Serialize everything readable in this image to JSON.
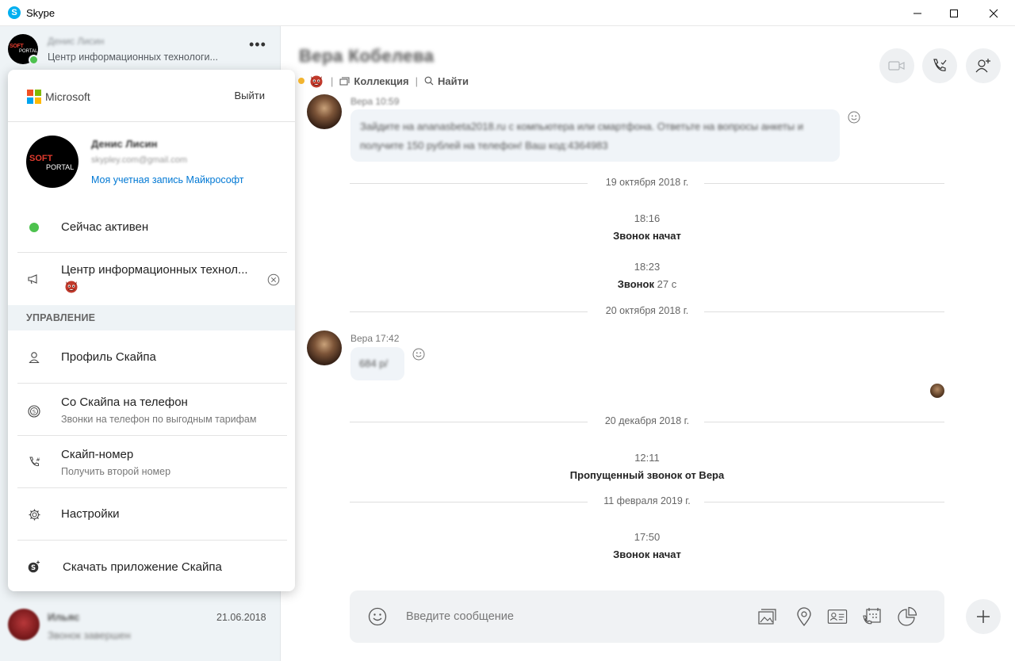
{
  "window": {
    "title": "Skype"
  },
  "sidebar": {
    "profile": {
      "name": "Денис Лисин",
      "status_message": "Центр информационных технологи..."
    },
    "contacts": [
      {
        "name": "Ильяс",
        "date": "21.06.2018",
        "preview": "Звонок завершен"
      }
    ]
  },
  "account_menu": {
    "brand": "Microsoft",
    "signout_label": "Выйти",
    "account_name": "Денис Лисин",
    "account_email": "skypley.com@gmail.com",
    "account_link": "Моя учетная запись Майкрософт",
    "presence_label": "Сейчас активен",
    "mood_text": "Центр информационных технол...",
    "section_title": "УПРАВЛЕНИЕ",
    "items": [
      {
        "label": "Профиль Скайпа",
        "sub": ""
      },
      {
        "label": "Со Скайпа на телефон",
        "sub": "Звонки на телефон по выгодным тарифам"
      },
      {
        "label": "Скайп-номер",
        "sub": "Получить второй номер"
      },
      {
        "label": "Настройки",
        "sub": ""
      },
      {
        "label": "Скачать приложение Скайпа",
        "sub": ""
      }
    ]
  },
  "chat": {
    "contact_name": "Вера Кобелева",
    "gallery_label": "Коллекция",
    "find_label": "Найти",
    "messages": [
      {
        "meta": "Вера 10:59",
        "text": "Зайдите на ananasbeta2018.ru с компьютера или смартфона. Ответьте на вопросы анкеты и получите 150 рублей на телефон! Ваш код:4364983"
      },
      {
        "meta": "Вера 17:42",
        "text": "684 р/"
      }
    ],
    "separators": [
      "19 октября 2018 г.",
      "20 октября 2018 г.",
      "20 декабря 2018 г.",
      "11 февраля 2019 г."
    ],
    "events": [
      {
        "time": "18:16",
        "text": "Звонок начат",
        "duration": ""
      },
      {
        "time": "18:23",
        "text": "Звонок",
        "duration": "27 с"
      },
      {
        "time": "12:11",
        "text": "Пропущенный звонок от Вера",
        "duration": ""
      },
      {
        "time": "17:50",
        "text": "Звонок начат",
        "duration": ""
      }
    ],
    "composer_placeholder": "Введите сообщение"
  },
  "colors": {
    "accent": "#0078d4",
    "online": "#4dc24e",
    "sidebar_bg": "#eef3f6",
    "bubble_bg": "#f0f4f8"
  }
}
